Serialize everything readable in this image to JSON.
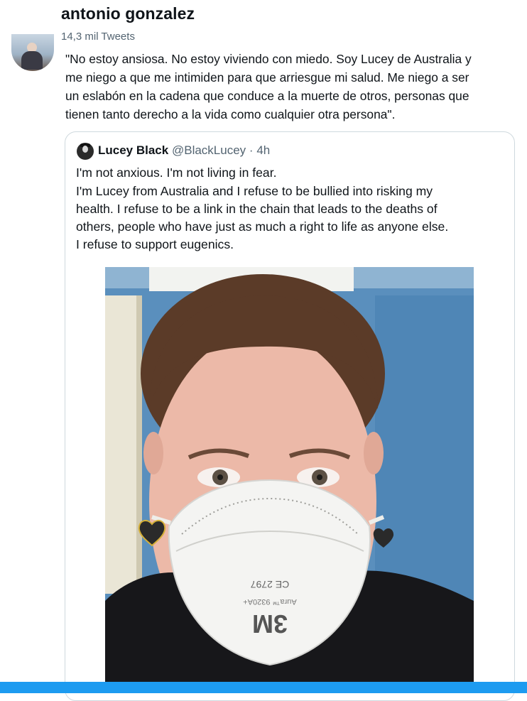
{
  "profile": {
    "name": "antonio gonzalez",
    "tweet_count": "14,3 mil Tweets"
  },
  "tweet": {
    "lines": [
      "\"No estoy ansiosa. No estoy viviendo con miedo. Soy Lucey de Australia y",
      "me niego a que me intimiden para que arriesgue mi salud. Me niego a ser",
      "un eslabón en la cadena que conduce a la muerte de otros, personas que",
      "tienen tanto derecho a la vida como cualquier otra persona\"."
    ]
  },
  "quote": {
    "author_name": "Lucey Black",
    "author_handle": "@BlackLucey",
    "separator": "·",
    "time": "4h",
    "lines": [
      "I'm not anxious. I'm not living in fear.",
      "I'm Lucey from Australia and I refuse to be bullied into risking my",
      "health. I refuse to be a link in the chain that leads to the deaths of",
      "others, people who have just as much a right to life as anyone else.",
      "I refuse to support eugenics."
    ],
    "image": {
      "mask_brand": "3M",
      "mask_model": "Aura™ 9320A+",
      "mask_mark": "CE 2797"
    }
  },
  "colors": {
    "text": "#0f1419",
    "secondary": "#536471",
    "border": "#cfd9de",
    "accent": "#1d9bf0"
  }
}
